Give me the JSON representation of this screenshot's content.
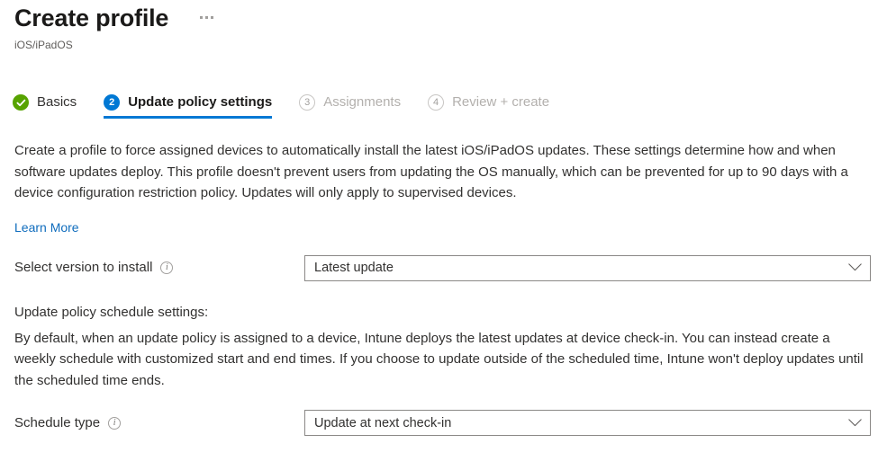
{
  "header": {
    "title": "Create profile",
    "subtitle": "iOS/iPadOS",
    "more_menu_label": "..."
  },
  "wizard": {
    "steps": [
      {
        "marker": "✓",
        "label": "Basics",
        "state": "done"
      },
      {
        "marker": "2",
        "label": "Update policy settings",
        "state": "active"
      },
      {
        "marker": "3",
        "label": "Assignments",
        "state": "upcoming"
      },
      {
        "marker": "4",
        "label": "Review + create",
        "state": "upcoming"
      }
    ]
  },
  "body": {
    "description": "Create a profile to force assigned devices to automatically install the latest iOS/iPadOS updates. These settings determine how and when software updates deploy. This profile doesn't prevent users from updating the OS manually, which can be prevented for up to 90 days with a device configuration restriction policy. Updates will only apply to supervised devices.",
    "learn_more_label": "Learn More",
    "schedule_section_label": "Update policy schedule settings:",
    "schedule_description": "By default, when an update policy is assigned to a device, Intune deploys the latest updates at device check-in. You can instead create a weekly schedule with customized start and end times. If you choose to update outside of the scheduled time, Intune won't deploy updates until the scheduled time ends."
  },
  "fields": {
    "version": {
      "label": "Select version to install",
      "info_glyph": "i",
      "value": "Latest update"
    },
    "schedule_type": {
      "label": "Schedule type",
      "info_glyph": "i",
      "value": "Update at next check-in"
    }
  },
  "colors": {
    "accent": "#0078d4",
    "link": "#0f6cbd",
    "success": "#57a300",
    "text": "#323130",
    "muted": "#b3b0ad"
  }
}
